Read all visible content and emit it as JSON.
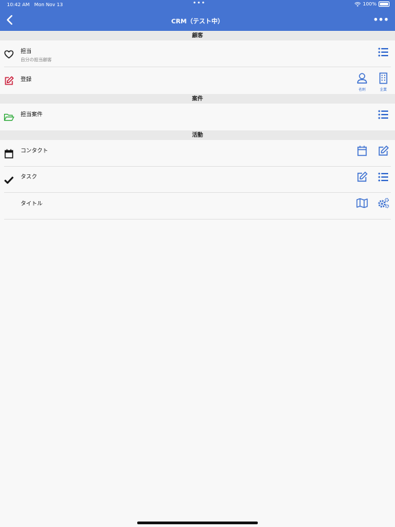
{
  "status_bar": {
    "time": "10:42 AM",
    "date": "Mon Nov 13",
    "battery": "100%"
  },
  "nav": {
    "title": "CRM（テスト中）",
    "back_icon": "chevron-left-icon",
    "more_icon": "ellipsis-icon"
  },
  "sections": {
    "customer": {
      "header": "顧客",
      "rows": {
        "assigned": {
          "label": "担当",
          "sublabel": "自分の担当顧客"
        },
        "register": {
          "label": "登録",
          "card_label": "名刺",
          "company_label": "企業"
        }
      }
    },
    "deals": {
      "header": "案件",
      "rows": {
        "assigned_deals": {
          "label": "担当案件"
        }
      }
    },
    "activity": {
      "header": "活動",
      "rows": {
        "contact": {
          "label": "コンタクト"
        },
        "task": {
          "label": "タスク"
        },
        "title": {
          "label": "タイトル"
        }
      }
    }
  },
  "colors": {
    "accent": "#4574d2",
    "icon_blue": "#3a6fd0",
    "edit_red": "#c8102e",
    "folder_green": "#2eaa3a"
  }
}
